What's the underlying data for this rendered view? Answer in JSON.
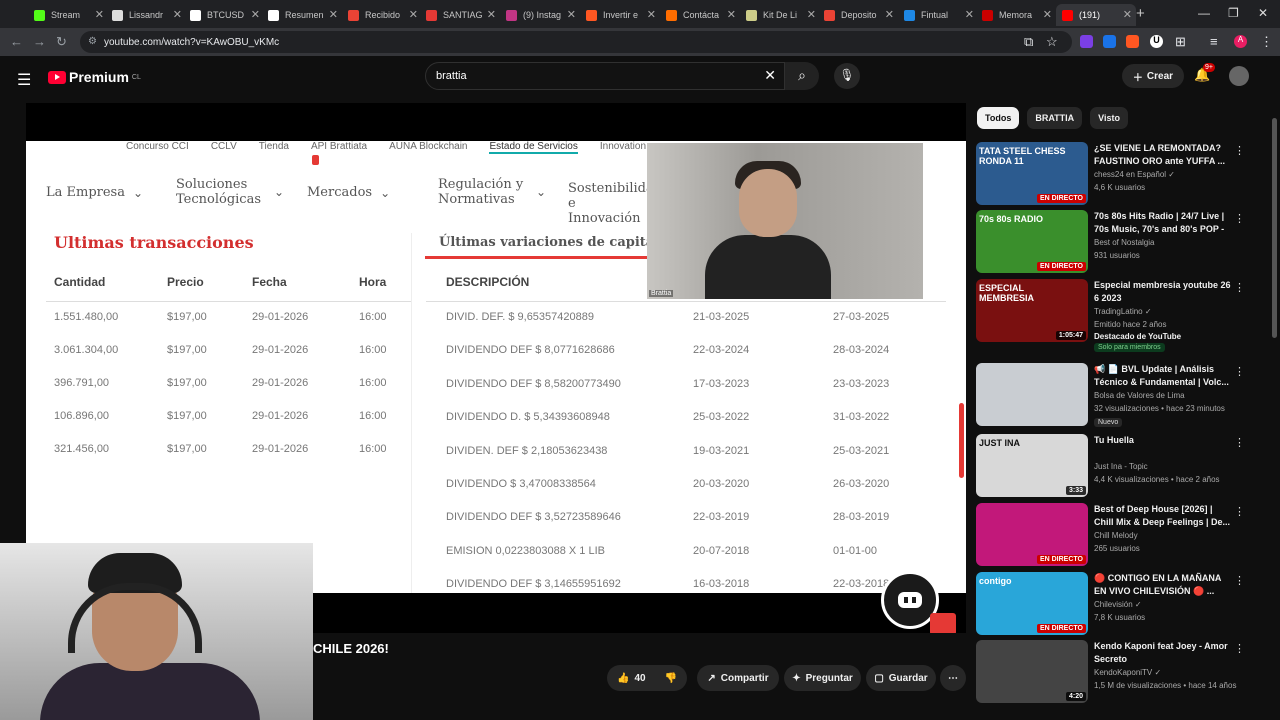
{
  "browser": {
    "tabs": [
      {
        "label": "Stream",
        "color": "#53fc18"
      },
      {
        "label": "Lissandr",
        "color": "#dddddd"
      },
      {
        "label": "BTCUSD",
        "color": "#ffffff"
      },
      {
        "label": "Resumen",
        "color": "#ffffff"
      },
      {
        "label": "Recibido",
        "color": "#ea4335"
      },
      {
        "label": "SANTIAG",
        "color": "#e53935"
      },
      {
        "label": "(9) Instag",
        "color": "#c13584"
      },
      {
        "label": "Invertir e",
        "color": "#ff5722"
      },
      {
        "label": "Contácta",
        "color": "#ff6d00"
      },
      {
        "label": "Kit De Li",
        "color": "#cccc88"
      },
      {
        "label": "Deposito",
        "color": "#ea4335"
      },
      {
        "label": "Fintual",
        "color": "#1e88e5"
      },
      {
        "label": "Memora",
        "color": "#cc0000"
      },
      {
        "label": "(191)",
        "color": "#ff0000"
      }
    ],
    "url": "youtube.com/watch?v=KAwOBU_vKMc",
    "profile_letter": "A",
    "ext_letter": "U"
  },
  "youtube": {
    "logo": "Premium",
    "region": "CL",
    "search_value": "brattia",
    "create_label": "Crear",
    "notif_badge": "9+",
    "video_title": "CHILE 2026!",
    "likes": "40",
    "share_label": "Compartir",
    "ask_label": "Preguntar",
    "save_label": "Guardar"
  },
  "video": {
    "topmenu": [
      "Concurso CCI",
      "CCLV",
      "Tienda",
      "API Brattiata",
      "AUNA Blockchain",
      "Estado de Servicios",
      "Innovation"
    ],
    "nav": [
      "La Empresa",
      "Soluciones Tecnológicas",
      "Mercados",
      "Regulación y Normativas",
      "Sostenibilidad e Innovación"
    ],
    "left_title": "Ultimas transacciones",
    "right_title": "Últimas variaciones de capital",
    "cam_name": "Brattia",
    "left_headers": [
      "Cantidad",
      "Precio",
      "Fecha",
      "Hora"
    ],
    "left_rows": [
      [
        "1.551.480,00",
        "$197,00",
        "29-01-2026",
        "16:00"
      ],
      [
        "3.061.304,00",
        "$197,00",
        "29-01-2026",
        "16:00"
      ],
      [
        "396.791,00",
        "$197,00",
        "29-01-2026",
        "16:00"
      ],
      [
        "106.896,00",
        "$197,00",
        "29-01-2026",
        "16:00"
      ],
      [
        "321.456,00",
        "$197,00",
        "29-01-2026",
        "16:00"
      ]
    ],
    "right_header": "DESCRIPCIÓN",
    "right_rows": [
      [
        "DIVID. DEF. $ 9,65357420889",
        "21-03-2025",
        "27-03-2025"
      ],
      [
        "DIVIDENDO DEF $ 8,0771628686",
        "22-03-2024",
        "28-03-2024"
      ],
      [
        "DIVIDENDO DEF $ 8,58200773490",
        "17-03-2023",
        "23-03-2023"
      ],
      [
        "DIVIDENDO D. $ 5,34393608948",
        "25-03-2022",
        "31-03-2022"
      ],
      [
        "DIVIDEN. DEF $ 2,18053623438",
        "19-03-2021",
        "25-03-2021"
      ],
      [
        "DIVIDENDO $ 3,47008338564",
        "20-03-2020",
        "26-03-2020"
      ],
      [
        "DIVIDENDO DEF $ 3,52723589646",
        "22-03-2019",
        "28-03-2019"
      ],
      [
        "EMISION 0,0223803088 X 1 LIB",
        "20-07-2018",
        "01-01-00"
      ],
      [
        "DIVIDENDO DEF $ 3,14655951692",
        "16-03-2018",
        "22-03-2018"
      ]
    ]
  },
  "sidebar": {
    "chips": [
      "Todos",
      "BRATTIA",
      "Visto"
    ],
    "items": [
      {
        "title": "¿SE VIENE LA REMONTADA? FAUSTINO ORO ante YUFFA ...",
        "channel": "chess24 en Español ✓",
        "meta": "4,6 K usuarios",
        "badge": "EN DIRECTO",
        "thumb_text": "TATA STEEL CHESS RONDA 11",
        "color": "#2c5b8f"
      },
      {
        "title": "70s 80s Hits Radio | 24/7 Live | 70s Music, 70's and 80's POP - ...",
        "channel": "Best of Nostalgia",
        "meta": "931 usuarios",
        "badge": "EN DIRECTO",
        "thumb_text": "70s 80s RADIO",
        "color": "#3a8f2c"
      },
      {
        "title": "Especial membresia youtube 26 6 2023",
        "channel": "TradingLatino ✓",
        "meta": "Emitido hace 2 años",
        "extra": "Destacado de YouTube",
        "member": "Solo para miembros",
        "badge": "1:05:47",
        "thumb_text": "ESPECIAL MEMBRESIA",
        "color": "#7a1010"
      },
      {
        "title": "📢 📄 BVL Update | Análisis Técnico & Fundamental | Volc...",
        "channel": "Bolsa de Valores de Lima",
        "meta": "32 visualizaciones • hace 23 minutos",
        "pill": "Nuevo",
        "thumb_text": "",
        "color": "#c9cdd2"
      },
      {
        "title": "Tu Huella",
        "channel": "Just Ina - Topic",
        "meta": "4,4 K visualizaciones • hace 2 años",
        "badge": "3:33",
        "thumb_text": "JUST INA",
        "color": "#d8d8d8"
      },
      {
        "title": "Best of Deep House [2026] | Chill Mix & Deep Feelings | De...",
        "channel": "Chill Melody",
        "meta": "265 usuarios",
        "badge": "EN DIRECTO",
        "thumb_text": "",
        "color": "#c2187a"
      },
      {
        "title": "🔴 CONTIGO EN LA MAÑANA EN VIVO CHILEVISIÓN 🔴 ...",
        "channel": "Chilevisión ✓",
        "meta": "7,8 K usuarios",
        "badge": "EN DIRECTO",
        "thumb_text": "contigo",
        "color": "#29a6d9"
      },
      {
        "title": "Kendo Kaponi feat Joey - Amor Secreto",
        "channel": "KendoKaponiTV ✓",
        "meta": "1,5 M de visualizaciones • hace 14 años",
        "badge": "4:20",
        "thumb_text": "",
        "color": "#444"
      }
    ]
  }
}
